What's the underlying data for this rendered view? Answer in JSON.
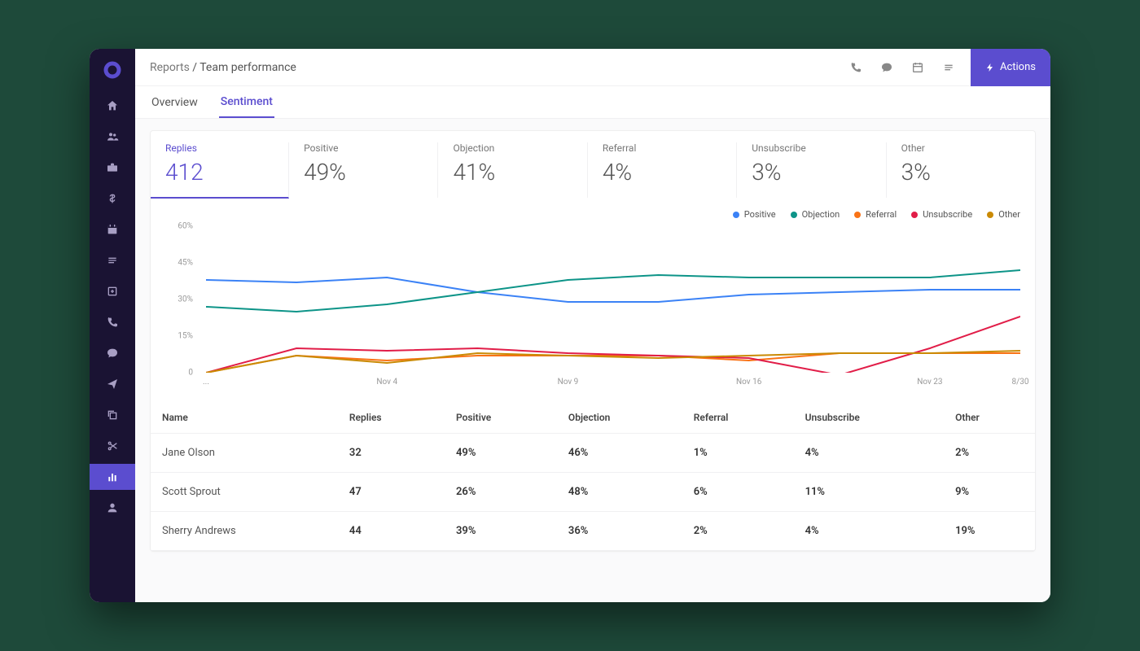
{
  "breadcrumb": {
    "parent": "Reports",
    "sep": " / ",
    "current": "Team performance"
  },
  "actions_button": "Actions",
  "tabs": [
    {
      "label": "Overview",
      "active": false
    },
    {
      "label": "Sentiment",
      "active": true
    }
  ],
  "metrics": [
    {
      "label": "Replies",
      "value": "412",
      "active": true
    },
    {
      "label": "Positive",
      "value": "49%"
    },
    {
      "label": "Objection",
      "value": "41%"
    },
    {
      "label": "Referral",
      "value": "4%"
    },
    {
      "label": "Unsubscribe",
      "value": "3%"
    },
    {
      "label": "Other",
      "value": "3%"
    }
  ],
  "legend": [
    {
      "name": "Positive",
      "color": "#3b82f6"
    },
    {
      "name": "Objection",
      "color": "#0d9488"
    },
    {
      "name": "Referral",
      "color": "#f97316"
    },
    {
      "name": "Unsubscribe",
      "color": "#e11d48"
    },
    {
      "name": "Other",
      "color": "#ca8a04"
    }
  ],
  "chart_data": {
    "type": "line",
    "x_labels": [
      "...",
      "Nov 4",
      "Nov 9",
      "Nov 16",
      "Nov 23",
      "8/30"
    ],
    "y_ticks": [
      0,
      15,
      30,
      45,
      60
    ],
    "ylim": [
      0,
      60
    ],
    "series": [
      {
        "name": "Positive",
        "color": "#3b82f6",
        "values": [
          38,
          37,
          39,
          33,
          29,
          29,
          32,
          33,
          34,
          34
        ]
      },
      {
        "name": "Objection",
        "color": "#0d9488",
        "values": [
          27,
          25,
          28,
          33,
          38,
          40,
          39,
          39,
          39,
          42
        ]
      },
      {
        "name": "Referral",
        "color": "#f97316",
        "values": [
          0,
          7,
          5,
          7,
          7,
          7,
          5,
          8,
          8,
          8
        ]
      },
      {
        "name": "Unsubscribe",
        "color": "#e11d48",
        "values": [
          0,
          10,
          9,
          10,
          8,
          7,
          6,
          -1,
          10,
          23
        ]
      },
      {
        "name": "Other",
        "color": "#ca8a04",
        "values": [
          0,
          7,
          4,
          8,
          7,
          6,
          7,
          8,
          8,
          9
        ]
      }
    ]
  },
  "table": {
    "columns": [
      "Name",
      "Replies",
      "Positive",
      "Objection",
      "Referral",
      "Unsubscribe",
      "Other"
    ],
    "rows": [
      [
        "Jane Olson",
        "32",
        "49%",
        "46%",
        "1%",
        "4%",
        "2%"
      ],
      [
        "Scott Sprout",
        "47",
        "26%",
        "48%",
        "6%",
        "11%",
        "9%"
      ],
      [
        "Sherry Andrews",
        "44",
        "39%",
        "36%",
        "2%",
        "4%",
        "19%"
      ]
    ]
  }
}
